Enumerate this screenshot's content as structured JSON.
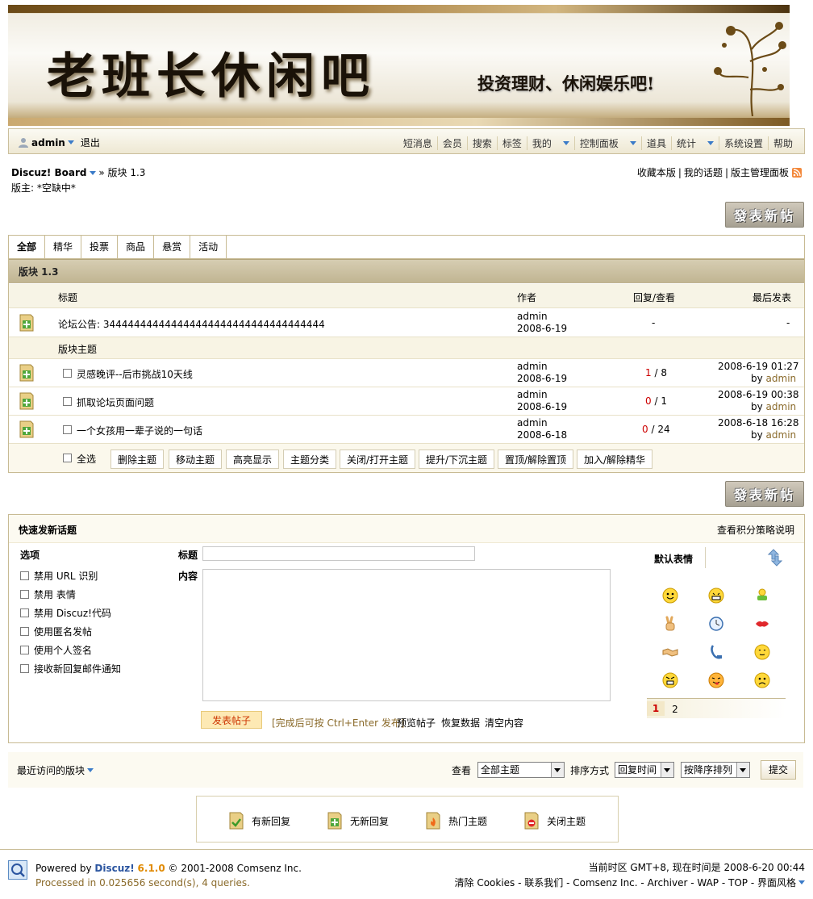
{
  "banner": {
    "title": "老班长休闲吧",
    "slogan": "投资理财、休闲娱乐吧!"
  },
  "userbar": {
    "username": "admin",
    "logout": "退出",
    "nav": [
      "短消息",
      "会员",
      "搜索",
      "标签",
      "我的",
      "控制面板",
      "道具",
      "统计",
      "系统设置",
      "帮助"
    ]
  },
  "breadcrumb": {
    "home": "Discuz! Board",
    "sep": "»",
    "current": "版块 1.3",
    "moderators": "版主: *空缺中*"
  },
  "top_links": [
    "收藏本版",
    "我的话题",
    "版主管理面板"
  ],
  "post_button": "發表新帖",
  "tabs": [
    "全部",
    "精华",
    "投票",
    "商品",
    "悬赏",
    "活动"
  ],
  "forum_name": "版块 1.3",
  "columns": {
    "title": "标题",
    "author": "作者",
    "replies_views": "回复/查看",
    "last_post": "最后发表"
  },
  "announcement": {
    "title": "论坛公告: 344444444444444444444444444444444444",
    "author": "admin",
    "date": "2008-6-19",
    "stats": "-",
    "last": "-"
  },
  "section_label": "版块主题",
  "threads": [
    {
      "title": "灵感晚评--后市挑战10天线",
      "author": "admin",
      "date": "2008-6-19",
      "replies": "1",
      "slash": " / ",
      "views": "8",
      "last_time": "2008-6-19 01:27",
      "last_by": "by",
      "last_user": "admin"
    },
    {
      "title": "抓取论坛页面问题",
      "author": "admin",
      "date": "2008-6-19",
      "replies": "0",
      "slash": " / ",
      "views": "1",
      "last_time": "2008-6-19 00:38",
      "last_by": "by",
      "last_user": "admin"
    },
    {
      "title": "一个女孩用一辈子说的一句话",
      "author": "admin",
      "date": "2008-6-18",
      "replies": "0",
      "slash": " / ",
      "views": "24",
      "last_time": "2008-6-18 16:28",
      "last_by": "by",
      "last_user": "admin"
    }
  ],
  "moderation": {
    "select_all": "全选",
    "buttons": [
      "删除主题",
      "移动主题",
      "高亮显示",
      "主题分类",
      "关闭/打开主题",
      "提升/下沉主题",
      "置顶/解除置顶",
      "加入/解除精华"
    ]
  },
  "quickpost": {
    "title": "快速发新话题",
    "policy": "查看积分策略说明",
    "options_title": "选项",
    "options": [
      "禁用 URL 识别",
      "禁用 表情",
      "禁用 Discuz!代码",
      "使用匿名发帖",
      "使用个人签名",
      "接收新回复邮件通知"
    ],
    "subject_label": "标题",
    "content_label": "内容",
    "subject_value": "",
    "submit": "发表帖子",
    "hint": "[完成后可按 Ctrl+Enter 发布]",
    "actions": [
      "预览帖子",
      "恢复数据",
      "清空内容"
    ],
    "smilies_title": "默认表情",
    "smilies_pages": [
      "1",
      "2"
    ]
  },
  "filters": {
    "recent": "最近访问的版块",
    "view_label": "查看",
    "view_value": "全部主题",
    "sort_label": "排序方式",
    "sort_value": "回复时间",
    "order_value": "按降序排列",
    "submit": "提交"
  },
  "legend": [
    "有新回复",
    "无新回复",
    "热门主题",
    "关闭主题"
  ],
  "footer": {
    "powered_by": "Powered by ",
    "brand": "Discuz!",
    "version": "6.1.0",
    "copyright": " © 2001-2008 Comsenz Inc.",
    "processed": "Processed in 0.025656 second(s), 4 queries.",
    "timezone": "当前时区 GMT+8, 现在时间是 2008-6-20 00:44",
    "links": [
      "清除 Cookies",
      "联系我们",
      "Comsenz Inc.",
      "Archiver",
      "WAP",
      "TOP",
      "界面风格"
    ]
  },
  "colors": {
    "accent_red": "#cc0000",
    "link_blue": "#2b55a0",
    "border": "#c8bb94"
  }
}
